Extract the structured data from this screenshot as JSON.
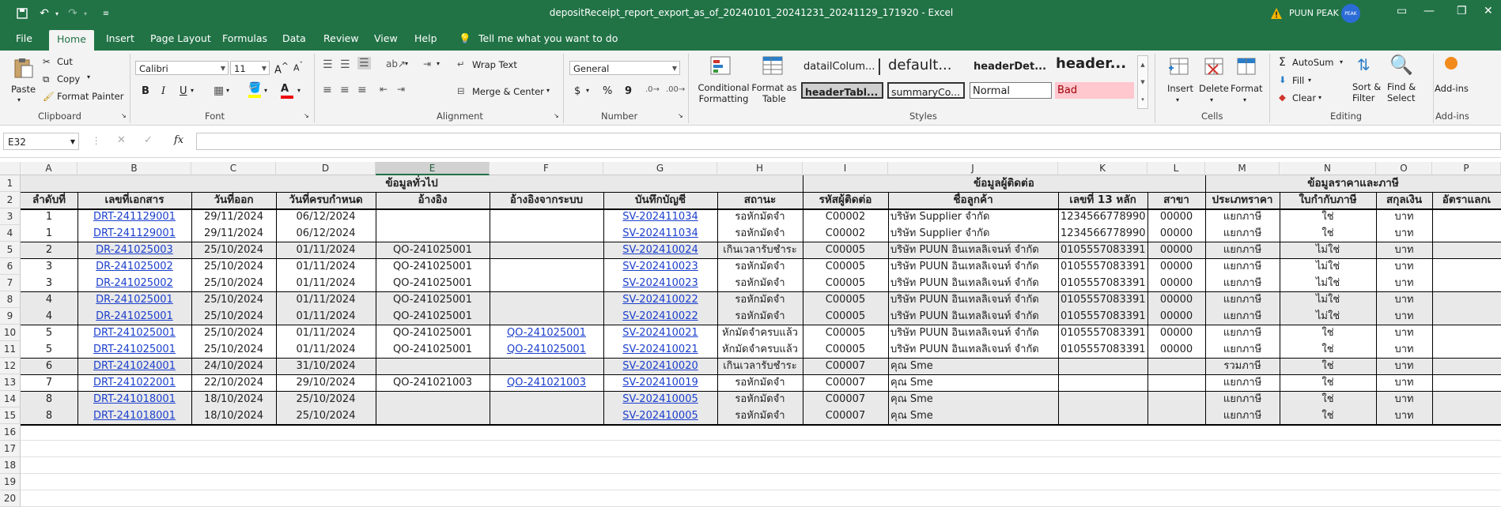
{
  "window": {
    "title": "depositReceipt_report_export_as_of_20240101_20241231_20241129_171920 - Excel",
    "user_name": "PUUN PEAK",
    "avatar_initials": "PEAK"
  },
  "ribbon_tabs": [
    "File",
    "Home",
    "Insert",
    "Page Layout",
    "Formulas",
    "Data",
    "Review",
    "View",
    "Help"
  ],
  "tell_me": "Tell me what you want to do",
  "ribbon": {
    "clipboard": {
      "paste": "Paste",
      "cut": "Cut",
      "copy": "Copy",
      "format_painter": "Format Painter",
      "label": "Clipboard"
    },
    "font": {
      "name": "Calibri",
      "size": "11",
      "label": "Font",
      "bold": "B",
      "italic": "I",
      "underline": "U"
    },
    "alignment": {
      "wrap": "Wrap Text",
      "merge": "Merge & Center",
      "label": "Alignment"
    },
    "number": {
      "format": "General",
      "label": "Number",
      "currency": "$",
      "percent": "%",
      "comma": "9"
    },
    "styles": {
      "conditional": "Conditional Formatting",
      "format_table": "Format as Table",
      "label": "Styles",
      "cells": [
        "datailColum...",
        "default...",
        "headerDet...",
        "header...",
        "headerTabl...",
        "summaryCo...",
        "Normal",
        "Bad"
      ]
    },
    "cells": {
      "insert": "Insert",
      "delete": "Delete",
      "format": "Format",
      "label": "Cells"
    },
    "editing": {
      "autosum": "AutoSum",
      "fill": "Fill",
      "clear": "Clear",
      "sort": "Sort & Filter",
      "find": "Find & Select",
      "label": "Editing"
    },
    "addins": {
      "button": "Add-ins",
      "label": "Add-ins"
    }
  },
  "name_box": "E32",
  "columns": [
    "A",
    "B",
    "C",
    "D",
    "E",
    "F",
    "G",
    "H",
    "I",
    "J",
    "K",
    "L",
    "M",
    "N",
    "O",
    "P"
  ],
  "selected_column": "E",
  "row_numbers": [
    "1",
    "2",
    "3",
    "4",
    "5",
    "6",
    "7",
    "8",
    "9",
    "10",
    "11",
    "12",
    "13",
    "14",
    "15",
    "16",
    "17",
    "18",
    "19",
    "20"
  ],
  "section_headers": [
    "ข้อมูลทั่วไป",
    "ข้อมูลผู้ติดต่อ",
    "ข้อมูลราคาและภาษี"
  ],
  "headers": [
    "ลำดับที่",
    "เลขที่เอกสาร",
    "วันที่ออก",
    "วันที่ครบกำหนด",
    "อ้างอิง",
    "อ้างอิงจากระบบ",
    "บันทึกบัญชี",
    "สถานะ",
    "รหัสผู้ติดต่อ",
    "ชื่อลูกค้า",
    "เลขที่ 13 หลัก",
    "สาขา",
    "ประเภทราคา",
    "ใบกำกับภาษี",
    "สกุลเงิน",
    "อัตราแลกเ"
  ],
  "rows": [
    [
      "1",
      "DRT-241129001",
      "29/11/2024",
      "06/12/2024",
      "",
      "",
      "SV-202411034",
      "รอหักมัดจำ",
      "C00002",
      "บริษัท Supplier จำกัด",
      "1234566778990",
      "00000",
      "แยกภาษี",
      "ใช่",
      "บาท"
    ],
    [
      "1",
      "DRT-241129001",
      "29/11/2024",
      "06/12/2024",
      "",
      "",
      "SV-202411034",
      "รอหักมัดจำ",
      "C00002",
      "บริษัท Supplier จำกัด",
      "1234566778990",
      "00000",
      "แยกภาษี",
      "ใช่",
      "บาท"
    ],
    [
      "2",
      "DR-241025003",
      "25/10/2024",
      "01/11/2024",
      "QO-241025001",
      "",
      "SV-202410024",
      "เกินเวลารับชำระ",
      "C00005",
      "บริษัท PUUN อินเทลลิเจนท์ จำกัด",
      "0105557083391",
      "00000",
      "แยกภาษี",
      "ไม่ใช่",
      "บาท"
    ],
    [
      "3",
      "DR-241025002",
      "25/10/2024",
      "01/11/2024",
      "QO-241025001",
      "",
      "SV-202410023",
      "รอหักมัดจำ",
      "C00005",
      "บริษัท PUUN อินเทลลิเจนท์ จำกัด",
      "0105557083391",
      "00000",
      "แยกภาษี",
      "ไม่ใช่",
      "บาท"
    ],
    [
      "3",
      "DR-241025002",
      "25/10/2024",
      "01/11/2024",
      "QO-241025001",
      "",
      "SV-202410023",
      "รอหักมัดจำ",
      "C00005",
      "บริษัท PUUN อินเทลลิเจนท์ จำกัด",
      "0105557083391",
      "00000",
      "แยกภาษี",
      "ไม่ใช่",
      "บาท"
    ],
    [
      "4",
      "DR-241025001",
      "25/10/2024",
      "01/11/2024",
      "QO-241025001",
      "",
      "SV-202410022",
      "รอหักมัดจำ",
      "C00005",
      "บริษัท PUUN อินเทลลิเจนท์ จำกัด",
      "0105557083391",
      "00000",
      "แยกภาษี",
      "ไม่ใช่",
      "บาท"
    ],
    [
      "4",
      "DR-241025001",
      "25/10/2024",
      "01/11/2024",
      "QO-241025001",
      "",
      "SV-202410022",
      "รอหักมัดจำ",
      "C00005",
      "บริษัท PUUN อินเทลลิเจนท์ จำกัด",
      "0105557083391",
      "00000",
      "แยกภาษี",
      "ไม่ใช่",
      "บาท"
    ],
    [
      "5",
      "DRT-241025001",
      "25/10/2024",
      "01/11/2024",
      "QO-241025001",
      "QO-241025001",
      "SV-202410021",
      "หักมัดจำครบแล้ว",
      "C00005",
      "บริษัท PUUN อินเทลลิเจนท์ จำกัด",
      "0105557083391",
      "00000",
      "แยกภาษี",
      "ใช่",
      "บาท"
    ],
    [
      "5",
      "DRT-241025001",
      "25/10/2024",
      "01/11/2024",
      "QO-241025001",
      "QO-241025001",
      "SV-202410021",
      "หักมัดจำครบแล้ว",
      "C00005",
      "บริษัท PUUN อินเทลลิเจนท์ จำกัด",
      "0105557083391",
      "00000",
      "แยกภาษี",
      "ใช่",
      "บาท"
    ],
    [
      "6",
      "DRT-241024001",
      "24/10/2024",
      "31/10/2024",
      "",
      "",
      "SV-202410020",
      "เกินเวลารับชำระ",
      "C00007",
      "คุณ Sme",
      "",
      "",
      "รวมภาษี",
      "ใช่",
      "บาท"
    ],
    [
      "7",
      "DRT-241022001",
      "22/10/2024",
      "29/10/2024",
      "QO-241021003",
      "QO-241021003",
      "SV-202410019",
      "รอหักมัดจำ",
      "C00007",
      "คุณ Sme",
      "",
      "",
      "แยกภาษี",
      "ใช่",
      "บาท"
    ],
    [
      "8",
      "DRT-241018001",
      "18/10/2024",
      "25/10/2024",
      "",
      "",
      "SV-202410005",
      "รอหักมัดจำ",
      "C00007",
      "คุณ Sme",
      "",
      "",
      "แยกภาษี",
      "ใช่",
      "บาท"
    ],
    [
      "8",
      "DRT-241018001",
      "18/10/2024",
      "25/10/2024",
      "",
      "",
      "SV-202410005",
      "รอหักมัดจำ",
      "C00007",
      "คุณ Sme",
      "",
      "",
      "แยกภาษี",
      "ใช่",
      "บาท"
    ]
  ],
  "colors": {
    "excel_green": "#217346",
    "link": "#1b3fcc",
    "band": "#e9e9e9",
    "bad_fill": "#ffc7ce",
    "bad_text": "#9c0006"
  }
}
